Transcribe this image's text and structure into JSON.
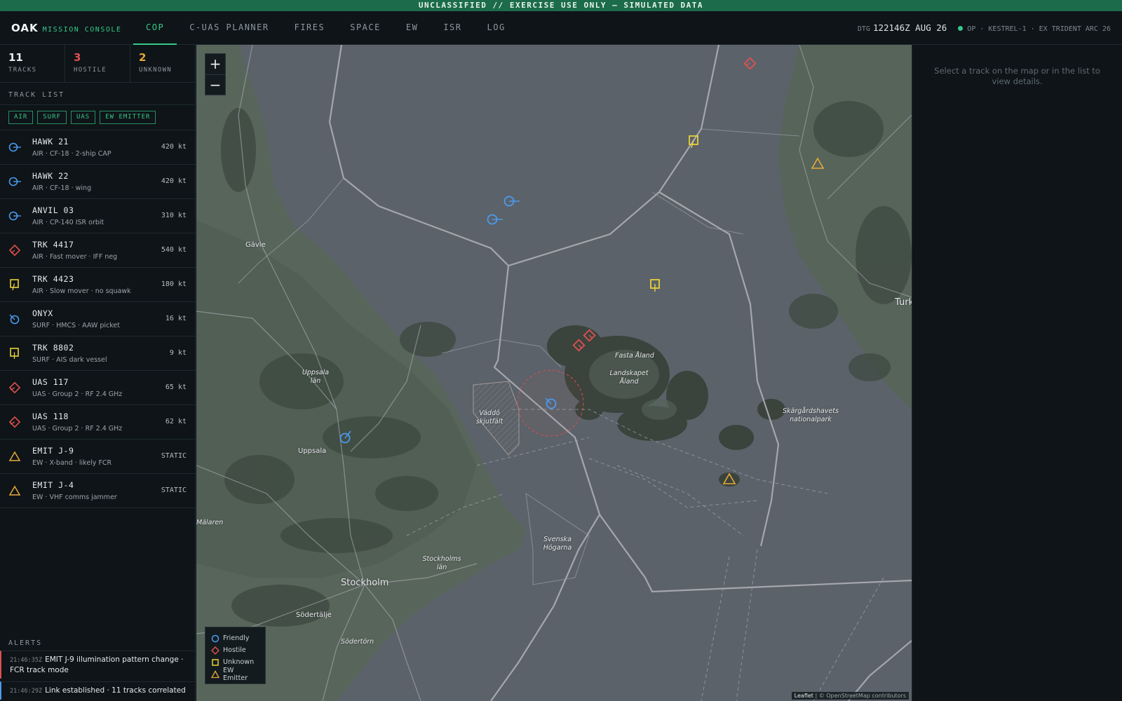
{
  "banner": "UNCLASSIFIED // EXERCISE USE ONLY — SIMULATED DATA",
  "brand": {
    "name": "OAK",
    "sub": "MISSION CONSOLE"
  },
  "tabs": [
    "COP",
    "C-UAS PLANNER",
    "FIRES",
    "SPACE",
    "EW",
    "ISR",
    "LOG"
  ],
  "active_tab": "COP",
  "status": {
    "dtg_label": "DTG",
    "dtg": "122146Z AUG 26",
    "op": "OP · KESTREL-1 · EX TRIDENT ARC 26"
  },
  "counts": [
    {
      "value": "11",
      "label": "TRACKS",
      "color": "#e6ebed"
    },
    {
      "value": "3",
      "label": "HOSTILE",
      "color": "#e05050"
    },
    {
      "value": "2",
      "label": "UNKNOWN",
      "color": "#e8a83a"
    }
  ],
  "track_list_title": "TRACK LIST",
  "filters": [
    "AIR",
    "SURF",
    "UAS",
    "EW EMITTER"
  ],
  "tracks": [
    {
      "name": "HAWK 21",
      "sub": "AIR · CF-18 · 2-ship CAP",
      "speed": "420 kt",
      "icon": "friendly-air-icon"
    },
    {
      "name": "HAWK 22",
      "sub": "AIR · CF-18 · wing",
      "speed": "420 kt",
      "icon": "friendly-air-icon"
    },
    {
      "name": "ANVIL 03",
      "sub": "AIR · CP-140 ISR orbit",
      "speed": "310 kt",
      "icon": "friendly-air-icon"
    },
    {
      "name": "TRK 4417",
      "sub": "AIR · Fast mover · IFF neg",
      "speed": "540 kt",
      "icon": "hostile-air-icon"
    },
    {
      "name": "TRK 4423",
      "sub": "AIR · Slow mover · no squawk",
      "speed": "180 kt",
      "icon": "unknown-air-icon"
    },
    {
      "name": "ONYX",
      "sub": "SURF · HMCS · AAW picket",
      "speed": "16 kt",
      "icon": "friendly-surface-icon"
    },
    {
      "name": "TRK 8802",
      "sub": "SURF · AIS dark vessel",
      "speed": "9 kt",
      "icon": "unknown-surface-icon"
    },
    {
      "name": "UAS 117",
      "sub": "UAS · Group 2 · RF 2.4 GHz",
      "speed": "65 kt",
      "icon": "hostile-uas-icon"
    },
    {
      "name": "UAS 118",
      "sub": "UAS · Group 2 · RF 2.4 GHz",
      "speed": "62 kt",
      "icon": "hostile-uas-icon"
    },
    {
      "name": "EMIT J-9",
      "sub": "EW · X-band · likely FCR",
      "speed": "STATIC",
      "icon": "ew-emitter-icon"
    },
    {
      "name": "EMIT J-4",
      "sub": "EW · VHF comms jammer",
      "speed": "STATIC",
      "icon": "ew-emitter-icon"
    }
  ],
  "alerts_title": "ALERTS",
  "alerts": [
    {
      "ts": "21:46:35Z",
      "text": "EMIT J-9 illumination pattern change · FCR track mode"
    },
    {
      "ts": "21:46:29Z",
      "text": "Link established · 11 tracks correlated"
    }
  ],
  "map": {
    "zoom_in": "+",
    "zoom_out": "−",
    "places": [
      "Gävle",
      "Uppsala län",
      "Uppsala",
      "Mälaren",
      "Stockholm",
      "Stockholms län",
      "Södertälje",
      "Södertörn",
      "Väddö skjutfält",
      "Fasta Åland",
      "Landskapet Åland",
      "Svenska Högarna",
      "Skärgårdshavets nationalpark",
      "Turk"
    ],
    "legend": [
      "Friendly",
      "Hostile",
      "Unknown",
      "EW Emitter"
    ],
    "attribution_leaflet": "Leaflet",
    "attribution_osm": "| © OpenStreetMap contributors"
  },
  "detail_hint": "Select a track on the map or in the list to view details.",
  "colors": {
    "friendly": "#4a9bf0",
    "hostile": "#e05050",
    "unknown": "#e8d23a",
    "emitter": "#e8a83a",
    "accent": "#36c98a"
  }
}
